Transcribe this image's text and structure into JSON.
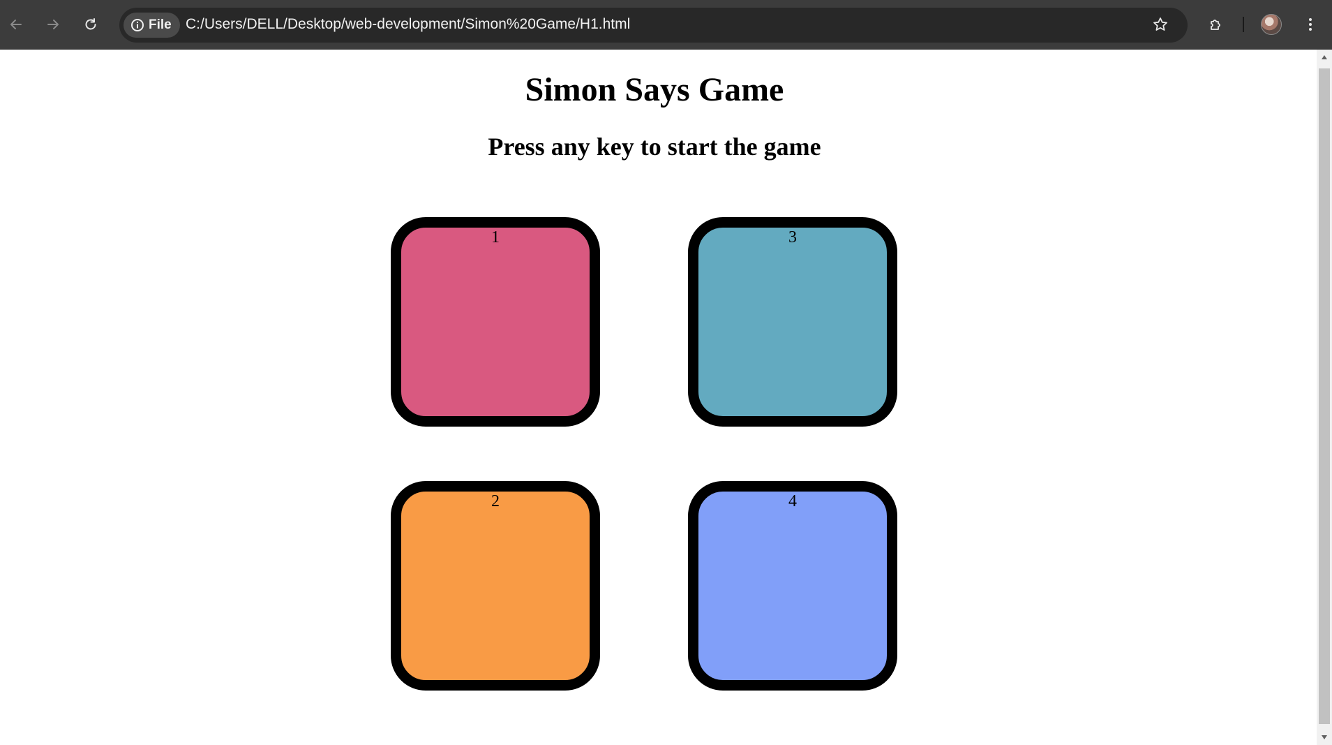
{
  "browser": {
    "site_chip_label": "File",
    "url": "C:/Users/DELL/Desktop/web-development/Simon%20Game/H1.html",
    "icons": {
      "back": "arrow-left-icon",
      "forward": "arrow-right-icon",
      "reload": "reload-icon",
      "site_info": "info-icon",
      "bookmark": "star-icon",
      "extensions": "puzzle-icon",
      "profile": "avatar",
      "menu": "kebab-menu-icon"
    },
    "colors": {
      "chrome_bg": "#3c3c3c",
      "omnibox_bg": "#282828",
      "text": "#f1f1f1"
    }
  },
  "page": {
    "title": "Simon Says Game",
    "subtitle": "Press any key to start the game",
    "buttons": [
      {
        "label": "1",
        "color": "#d95980"
      },
      {
        "label": "3",
        "color": "#63aac0"
      },
      {
        "label": "2",
        "color": "#f99b45"
      },
      {
        "label": "4",
        "color": "#819ff9"
      }
    ]
  }
}
